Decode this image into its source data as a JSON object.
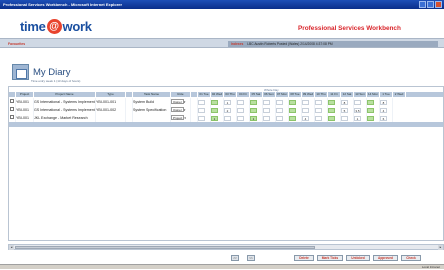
{
  "window": {
    "title": "Professional Services Workbench - Microsoft Internet Explorer"
  },
  "brand": {
    "logo_left": "time",
    "logo_at": "@",
    "logo_right": "work",
    "app_title": "Professional Services Workbench",
    "accent": "#d9252b"
  },
  "nav": {
    "favourites": "Favourites",
    "user_label": "Indexes",
    "user_info": "LBC Austin Roberts   Posted (Wales) 2/14/2008 4:37:08 PM"
  },
  "page": {
    "title": "My Diary",
    "subtitle": "Time entry week 1 (13 days of hours)",
    "group_label": "Whole Day"
  },
  "columns": [
    "",
    "Project",
    "Project Name",
    "Type",
    "",
    "Task Name",
    "Role",
    "",
    "01 Tue",
    "02 Wed",
    "03 Thu",
    "04 Fri",
    "05 Sat",
    "06 Sun",
    "07 Mon",
    "08 Tue",
    "09 Wed",
    "10 Thu",
    "11 Fri",
    "12 Sat",
    "13 Sun",
    "14 Mon",
    "1 Tue",
    "2 Wed"
  ],
  "rows": [
    {
      "project": "YBI-001",
      "name": "GS International - Systems Implementation",
      "type": "YBI-001-001",
      "task": "System Build",
      "role": "Owner",
      "hours": [
        "",
        "",
        "1",
        "",
        "",
        "",
        "",
        "",
        "",
        "",
        "",
        "8",
        "",
        "",
        "8"
      ]
    },
    {
      "project": "YBI-001",
      "name": "GS International - Systems Implementation",
      "type": "YBI-001-002",
      "task": "System Specification",
      "role": "Owner",
      "hours": [
        "",
        "",
        "2",
        "",
        "",
        "",
        "",
        "",
        "",
        "",
        "",
        "5",
        "3.5",
        "",
        "4"
      ]
    },
    {
      "project": "YBI-001",
      "name": "JKL Exchange - Market Research",
      "type": "",
      "task": "",
      "role": "Project",
      "hours": [
        "",
        "1",
        "",
        "",
        "1",
        "",
        "",
        "",
        "4",
        "",
        "",
        "",
        "1",
        "",
        "6"
      ]
    }
  ],
  "footer": {
    "prev": "<<",
    "next": ">>",
    "buttons": [
      "Delete",
      "Mark Ticks",
      "Unticked",
      "Approved",
      "Check"
    ]
  },
  "status": {
    "zone": "Local Intranet"
  }
}
